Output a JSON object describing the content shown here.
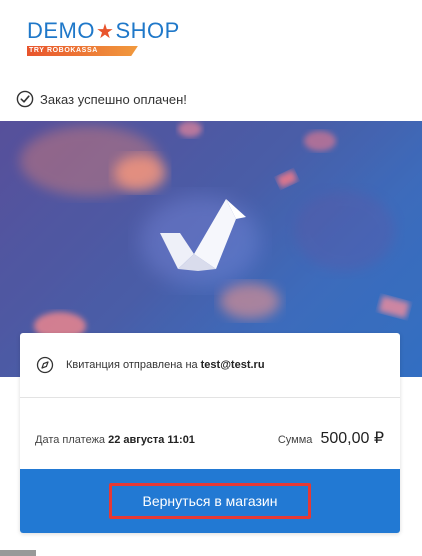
{
  "logo": {
    "text_left": "DEMO",
    "text_right": "SHOP",
    "star": "★",
    "sub": "TRY ROBOKASSA"
  },
  "status": {
    "text": "Заказ успешно оплачен!",
    "icon": "check-circle-icon"
  },
  "hero": {
    "icon": "checkmark-icon"
  },
  "receipt": {
    "label": "Квитанция отправлена на",
    "email": "test@test.ru",
    "icon": "compass-icon"
  },
  "payment": {
    "date_label": "Дата платежа",
    "date_value": "22 августа 11:01",
    "sum_label": "Сумма",
    "sum_value": "500,00 ₽"
  },
  "button": {
    "label": "Вернуться в магазин"
  },
  "colors": {
    "brand_blue": "#1f78c9",
    "brand_orange": "#e8542c",
    "footer_blue": "#2279d3",
    "highlight_red": "#e53935"
  }
}
